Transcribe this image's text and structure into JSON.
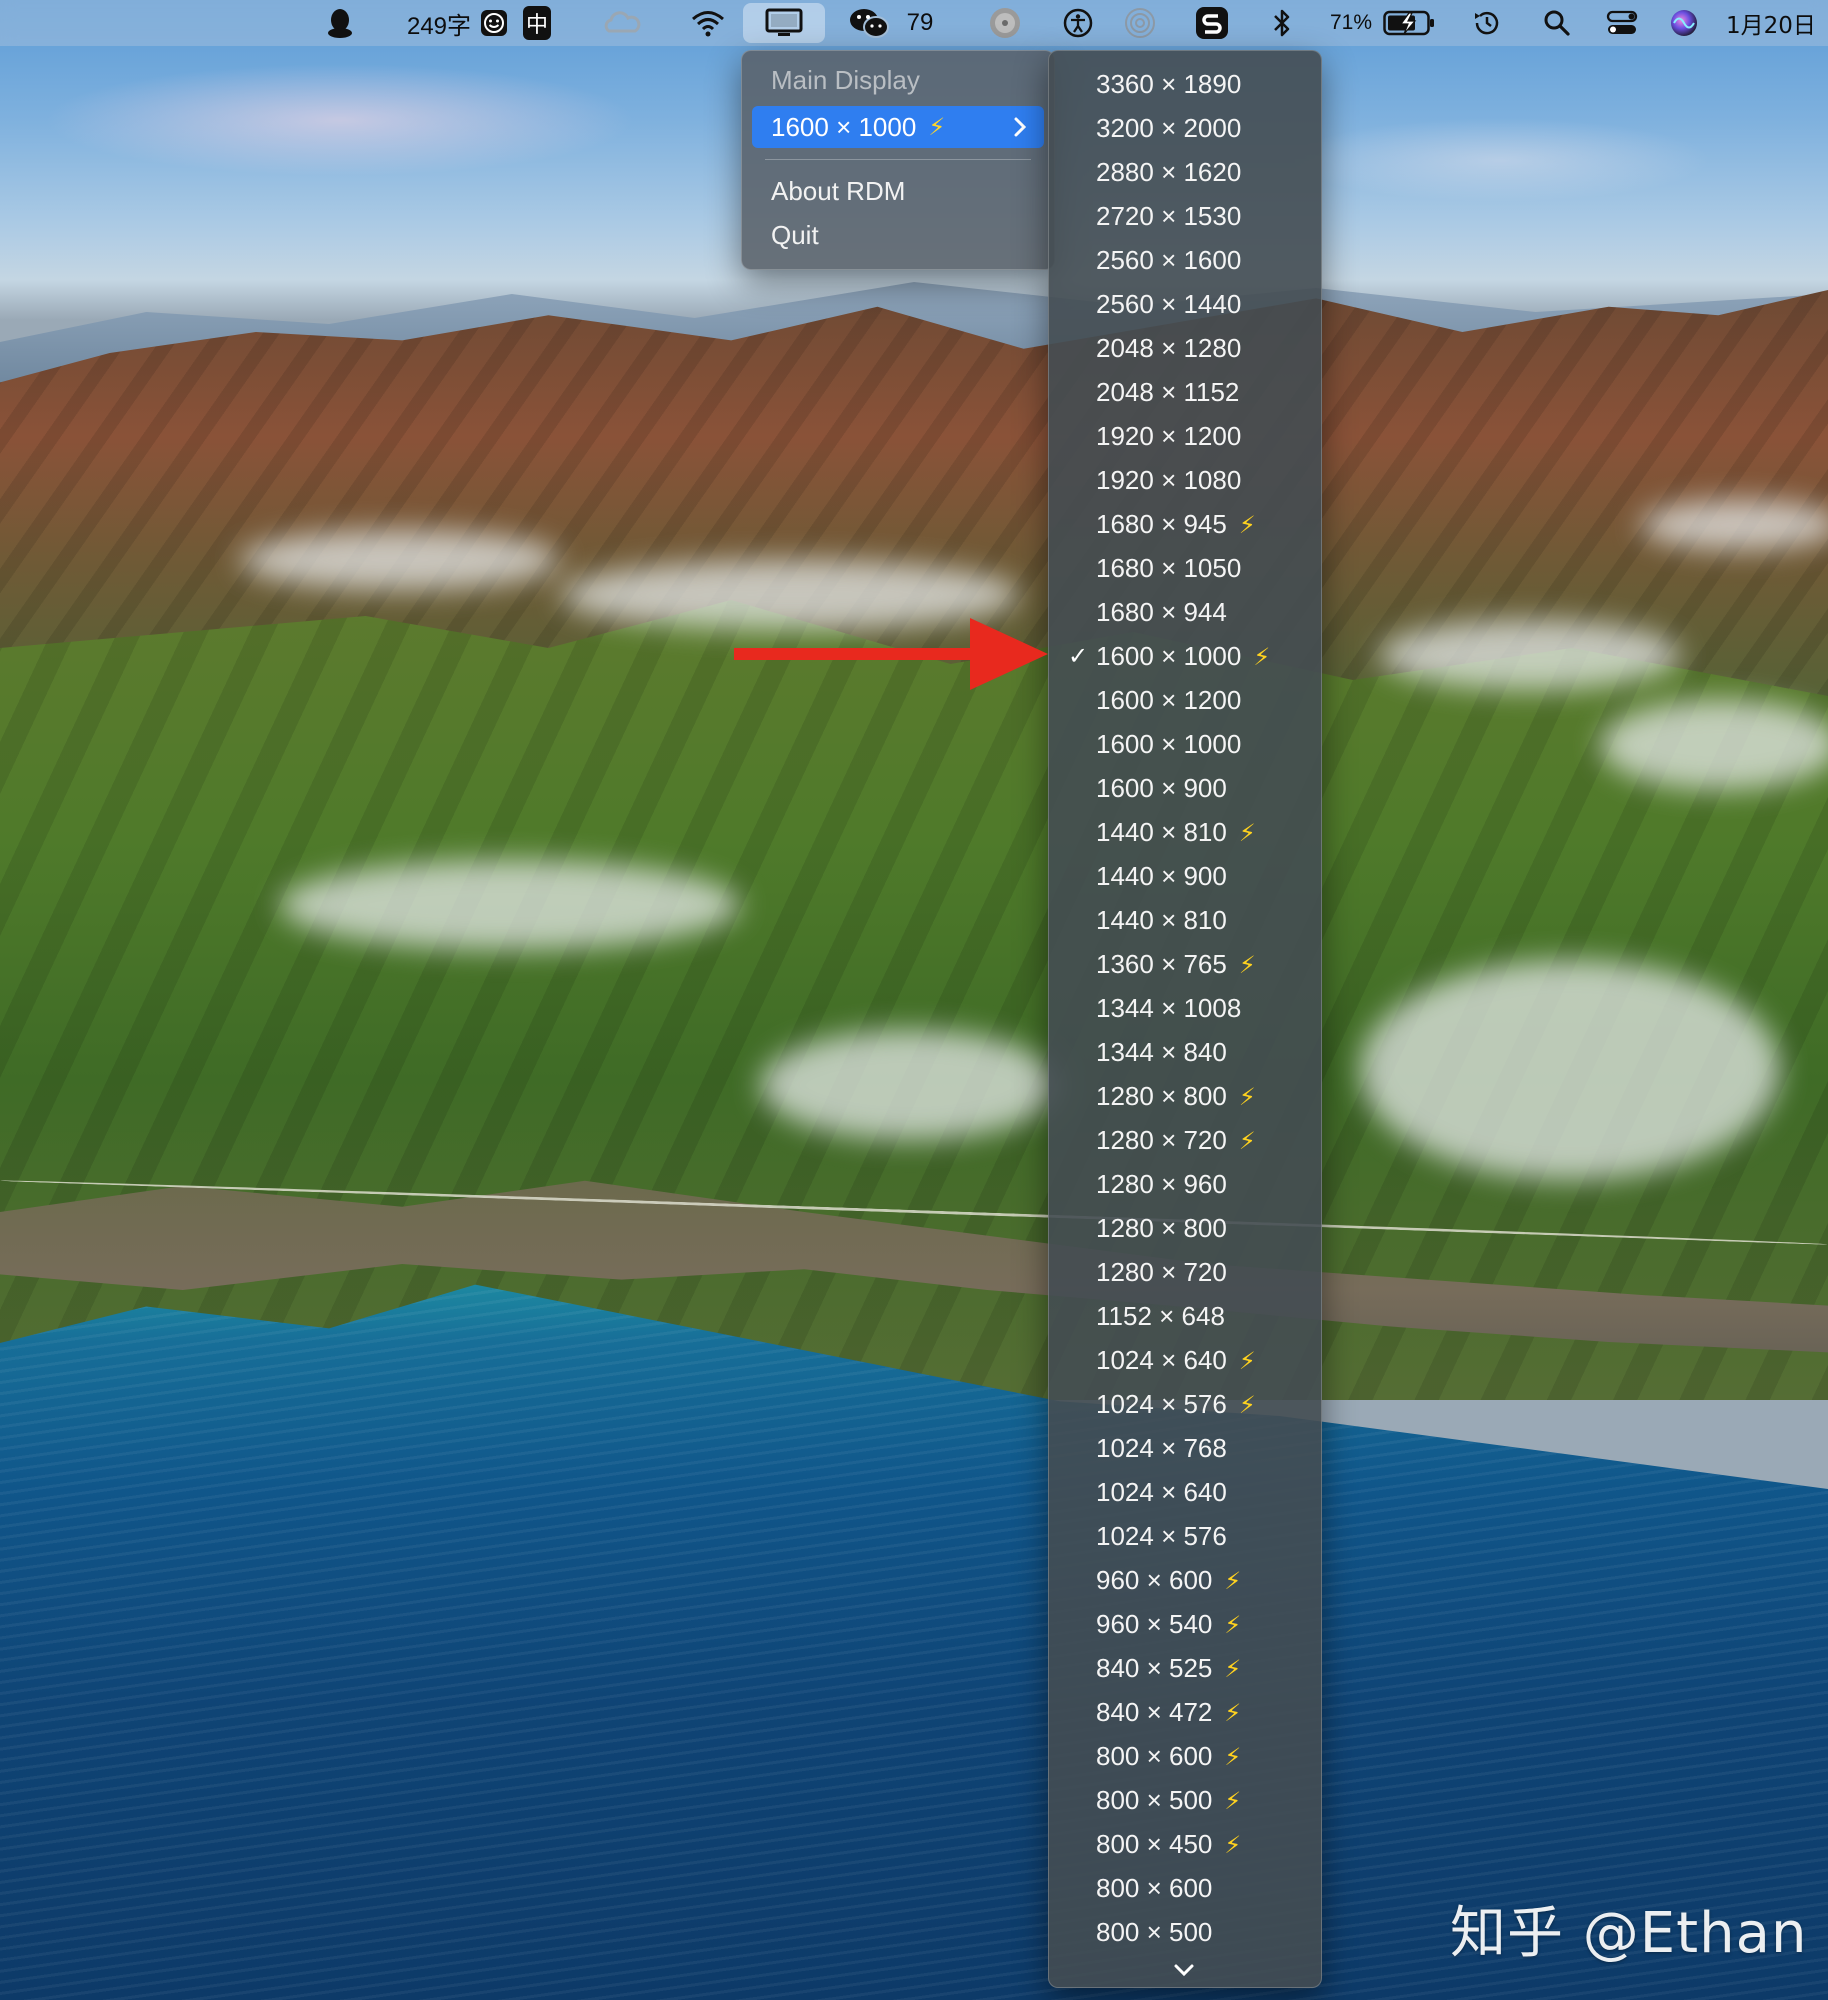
{
  "menubar": {
    "word_count": "249字",
    "input_method": "中",
    "wechat_count": "79",
    "battery": "71%",
    "date": "1月20日"
  },
  "rdm_menu": {
    "header": "Main Display",
    "selected_resolution": "1600 × 1000",
    "selected_hidpi": true,
    "about": "About RDM",
    "quit": "Quit"
  },
  "resolutions": [
    {
      "label": "3360 × 1890",
      "hidpi": false,
      "checked": false
    },
    {
      "label": "3200 × 2000",
      "hidpi": false,
      "checked": false
    },
    {
      "label": "2880 × 1620",
      "hidpi": false,
      "checked": false
    },
    {
      "label": "2720 × 1530",
      "hidpi": false,
      "checked": false
    },
    {
      "label": "2560 × 1600",
      "hidpi": false,
      "checked": false
    },
    {
      "label": "2560 × 1440",
      "hidpi": false,
      "checked": false
    },
    {
      "label": "2048 × 1280",
      "hidpi": false,
      "checked": false
    },
    {
      "label": "2048 × 1152",
      "hidpi": false,
      "checked": false
    },
    {
      "label": "1920 × 1200",
      "hidpi": false,
      "checked": false
    },
    {
      "label": "1920 × 1080",
      "hidpi": false,
      "checked": false
    },
    {
      "label": "1680 × 945",
      "hidpi": true,
      "checked": false
    },
    {
      "label": "1680 × 1050",
      "hidpi": false,
      "checked": false
    },
    {
      "label": "1680 × 944",
      "hidpi": false,
      "checked": false
    },
    {
      "label": "1600 × 1000",
      "hidpi": true,
      "checked": true
    },
    {
      "label": "1600 × 1200",
      "hidpi": false,
      "checked": false
    },
    {
      "label": "1600 × 1000",
      "hidpi": false,
      "checked": false
    },
    {
      "label": "1600 × 900",
      "hidpi": false,
      "checked": false
    },
    {
      "label": "1440 × 810",
      "hidpi": true,
      "checked": false
    },
    {
      "label": "1440 × 900",
      "hidpi": false,
      "checked": false
    },
    {
      "label": "1440 × 810",
      "hidpi": false,
      "checked": false
    },
    {
      "label": "1360 × 765",
      "hidpi": true,
      "checked": false
    },
    {
      "label": "1344 × 1008",
      "hidpi": false,
      "checked": false
    },
    {
      "label": "1344 × 840",
      "hidpi": false,
      "checked": false
    },
    {
      "label": "1280 × 800",
      "hidpi": true,
      "checked": false
    },
    {
      "label": "1280 × 720",
      "hidpi": true,
      "checked": false
    },
    {
      "label": "1280 × 960",
      "hidpi": false,
      "checked": false
    },
    {
      "label": "1280 × 800",
      "hidpi": false,
      "checked": false
    },
    {
      "label": "1280 × 720",
      "hidpi": false,
      "checked": false
    },
    {
      "label": "1152 × 648",
      "hidpi": false,
      "checked": false
    },
    {
      "label": "1024 × 640",
      "hidpi": true,
      "checked": false
    },
    {
      "label": "1024 × 576",
      "hidpi": true,
      "checked": false
    },
    {
      "label": "1024 × 768",
      "hidpi": false,
      "checked": false
    },
    {
      "label": "1024 × 640",
      "hidpi": false,
      "checked": false
    },
    {
      "label": "1024 × 576",
      "hidpi": false,
      "checked": false
    },
    {
      "label": "960 × 600",
      "hidpi": true,
      "checked": false
    },
    {
      "label": "960 × 540",
      "hidpi": true,
      "checked": false
    },
    {
      "label": "840 × 525",
      "hidpi": true,
      "checked": false
    },
    {
      "label": "840 × 472",
      "hidpi": true,
      "checked": false
    },
    {
      "label": "800 × 600",
      "hidpi": true,
      "checked": false
    },
    {
      "label": "800 × 500",
      "hidpi": true,
      "checked": false
    },
    {
      "label": "800 × 450",
      "hidpi": true,
      "checked": false
    },
    {
      "label": "800 × 600",
      "hidpi": false,
      "checked": false
    },
    {
      "label": "800 × 500",
      "hidpi": false,
      "checked": false
    }
  ],
  "glyphs": {
    "bolt": "⚡",
    "check": "✓"
  },
  "watermark": "知乎 @Ethan",
  "colors": {
    "menu_highlight": "#2f7ef0",
    "hidpi_bolt": "#ffd21f",
    "annotation_arrow": "#e8291e"
  }
}
